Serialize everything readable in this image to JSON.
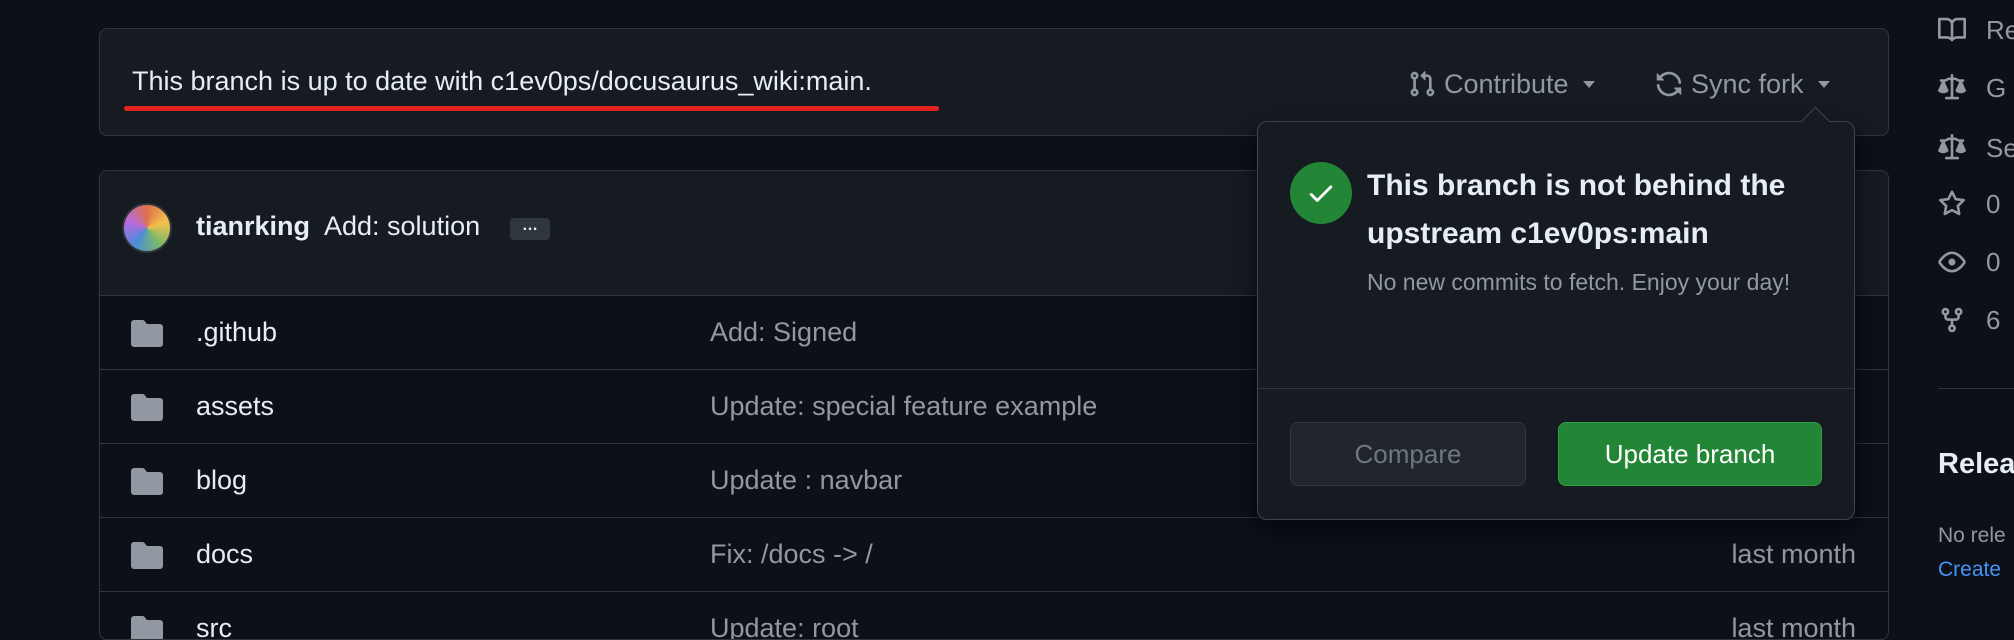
{
  "branch_status": {
    "message": "This branch is up to date with c1ev0ps/docusaurus_wiki:main.",
    "contribute_label": "Contribute",
    "sync_fork_label": "Sync fork"
  },
  "latest_commit": {
    "author": "tianrking",
    "message": "Add: solution",
    "ellipsis": "…"
  },
  "files": [
    {
      "name": ".github",
      "commit": "Add: Signed",
      "time": ""
    },
    {
      "name": "assets",
      "commit": "Update: special feature example",
      "time": ""
    },
    {
      "name": "blog",
      "commit": "Update : navbar",
      "time": ""
    },
    {
      "name": "docs",
      "commit": "Fix: /docs -> /",
      "time": "last month"
    },
    {
      "name": "src",
      "commit": "Update: root",
      "time": "last month"
    }
  ],
  "sync_popover": {
    "title": "This branch is not behind the upstream c1ev0ps:main",
    "description": "No new commits to fetch. Enjoy your day!",
    "compare_label": "Compare",
    "update_label": "Update branch"
  },
  "sidebar": {
    "items": [
      {
        "icon": "book-icon",
        "text": "Re"
      },
      {
        "icon": "law-icon",
        "text": "G"
      },
      {
        "icon": "law-icon",
        "text": "Se"
      },
      {
        "icon": "star-icon",
        "text": "0"
      },
      {
        "icon": "eye-icon",
        "text": "0"
      },
      {
        "icon": "fork-icon",
        "text": "6"
      }
    ],
    "releases_heading": "Relea",
    "no_releases": "No rele",
    "create_link": "Create"
  },
  "colors": {
    "background": "#0d1117",
    "panel": "#161b22",
    "border": "#30363d",
    "success": "#238636",
    "underline_annotation": "#e3231c",
    "link": "#4493f8"
  }
}
